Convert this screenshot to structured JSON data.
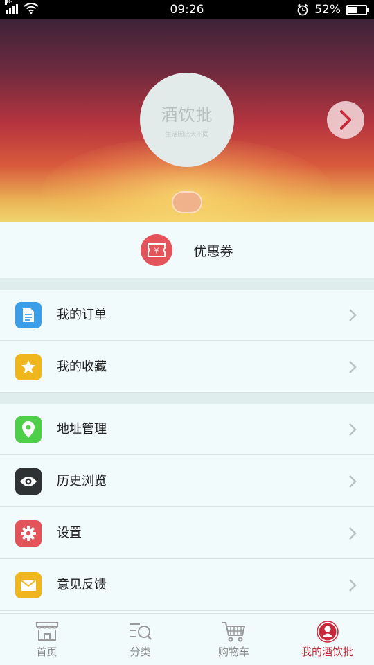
{
  "status_bar": {
    "network": "4G",
    "time": "09:26",
    "battery": "52%",
    "battery_level": 0.52
  },
  "header": {
    "logo_text": "酒饮批",
    "logo_slogan": "生活因此大不同"
  },
  "coupon": {
    "label": "优惠券",
    "icon": "coupon-icon",
    "color": "#e25459"
  },
  "menu": [
    {
      "label": "我的订单",
      "icon": "document-icon",
      "color": "#3a9ee8"
    },
    {
      "label": "我的收藏",
      "icon": "star-icon",
      "color": "#f0b61e"
    },
    {
      "label": "地址管理",
      "icon": "location-pin-icon",
      "color": "#4fce4a"
    },
    {
      "label": "历史浏览",
      "icon": "eye-icon",
      "color": "#2f3233"
    },
    {
      "label": "设置",
      "icon": "gear-icon",
      "color": "#e25459"
    },
    {
      "label": "意见反馈",
      "icon": "mail-icon",
      "color": "#f0b61e"
    }
  ],
  "tabs": [
    {
      "label": "首页",
      "icon": "storefront-icon"
    },
    {
      "label": "分类",
      "icon": "category-search-icon"
    },
    {
      "label": "购物车",
      "icon": "cart-icon"
    },
    {
      "label": "我的酒饮批",
      "icon": "user-icon",
      "active": true
    }
  ],
  "colors": {
    "accent": "#c8293a",
    "background": "#f1fbfb",
    "separator": "#dfeeed"
  }
}
